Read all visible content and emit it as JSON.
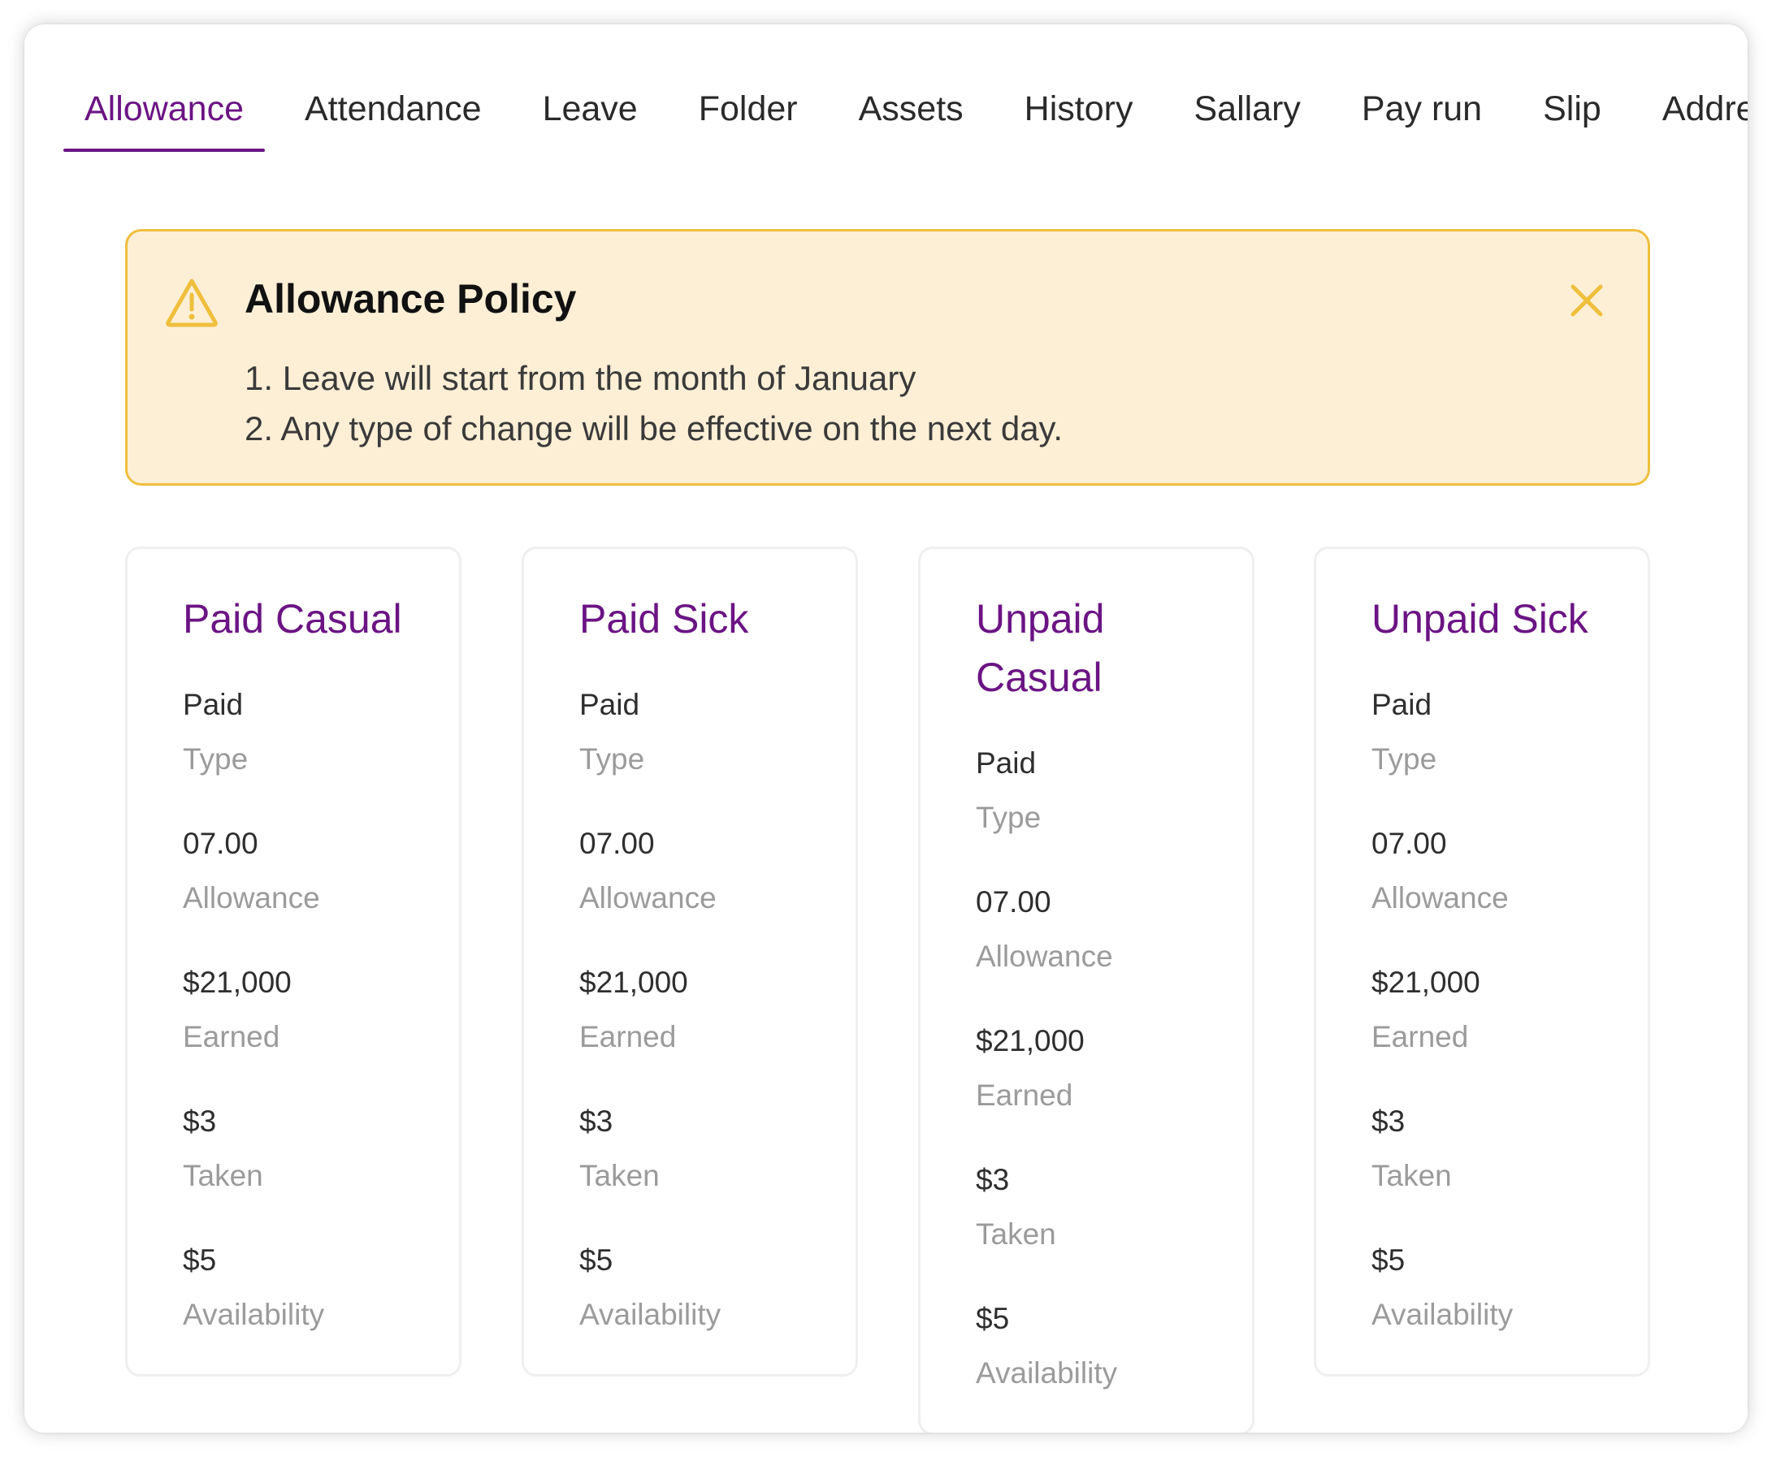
{
  "tabs": [
    "Allowance",
    "Attendance",
    "Leave",
    "Folder",
    "Assets",
    "History",
    "Sallary",
    "Pay run",
    "Slip",
    "Address"
  ],
  "active_tab": "Allowance",
  "alert": {
    "icon": "warning-icon",
    "title": "Allowance Policy",
    "close_icon": "close-icon",
    "items": [
      "1. Leave will start from the month of January",
      "2. Any type of change will be effective on the next day."
    ]
  },
  "cards": [
    {
      "title": "Paid Casual",
      "stats": [
        {
          "value": "Paid",
          "label": "Type"
        },
        {
          "value": "07.00",
          "label": "Allowance"
        },
        {
          "value": "$21,000",
          "label": "Earned"
        },
        {
          "value": "$3",
          "label": "Taken"
        },
        {
          "value": "$5",
          "label": "Availability"
        }
      ]
    },
    {
      "title": "Paid Sick",
      "stats": [
        {
          "value": "Paid",
          "label": "Type"
        },
        {
          "value": "07.00",
          "label": "Allowance"
        },
        {
          "value": "$21,000",
          "label": "Earned"
        },
        {
          "value": "$3",
          "label": "Taken"
        },
        {
          "value": "$5",
          "label": "Availability"
        }
      ]
    },
    {
      "title": "Unpaid Casual",
      "stats": [
        {
          "value": "Paid",
          "label": "Type"
        },
        {
          "value": "07.00",
          "label": "Allowance"
        },
        {
          "value": "$21,000",
          "label": "Earned"
        },
        {
          "value": "$3",
          "label": "Taken"
        },
        {
          "value": "$5",
          "label": "Availability"
        }
      ]
    },
    {
      "title": "Unpaid Sick",
      "stats": [
        {
          "value": "Paid",
          "label": "Type"
        },
        {
          "value": "07.00",
          "label": "Allowance"
        },
        {
          "value": "$21,000",
          "label": "Earned"
        },
        {
          "value": "$3",
          "label": "Taken"
        },
        {
          "value": "$5",
          "label": "Availability"
        }
      ]
    }
  ],
  "colors": {
    "accent": "#6b1484",
    "alert_bg": "#fdefd6",
    "alert_border": "#efbf3d",
    "label_gray": "#9b9b9b"
  }
}
